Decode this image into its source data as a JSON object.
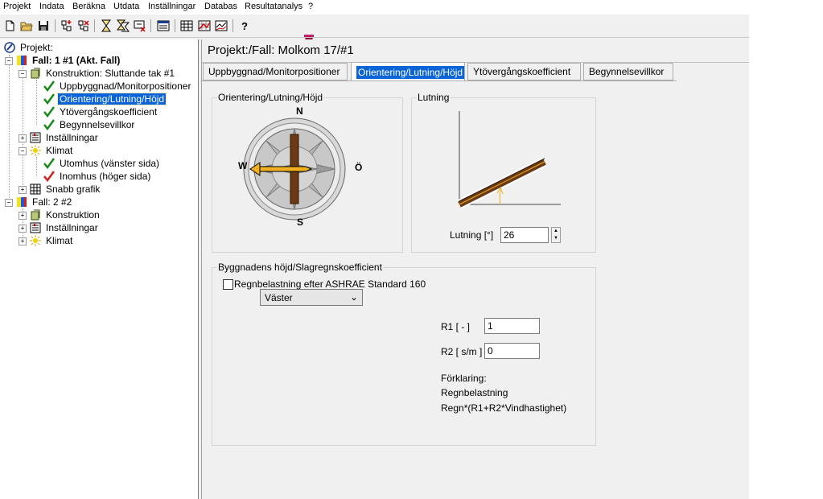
{
  "menu": [
    "Projekt",
    "Indata",
    "Beräkna",
    "Utdata",
    "Inställningar",
    "Databas",
    "Resultatanalys",
    "?"
  ],
  "toolbar": {
    "icons": [
      "new-file-icon",
      "open-folder-icon",
      "save-icon",
      "tree-add-icon",
      "tree-delete-icon",
      "calculate-icon",
      "calculate-multi-icon",
      "calculate-stop-icon",
      "report-icon",
      "grid-icon",
      "chart-grid-icon",
      "graph-icon",
      "help-icon",
      "exit-icon"
    ],
    "help_label": "?"
  },
  "tree": {
    "root": "Projekt:",
    "case1": "Fall: 1 #1 (Akt. Fall)",
    "construction1": "Konstruktion: Sluttande tak #1",
    "items1": [
      "Uppbyggnad/Monitorpositioner",
      "Orientering/Lutning/Höjd",
      "Ytövergångskoefficient",
      "Begynnelsevillkor"
    ],
    "settings1": "Inställningar",
    "climate1": "Klimat",
    "climate_items": [
      "Utomhus (vänster sida)",
      "Inomhus (höger sida)"
    ],
    "quick_graph": "Snabb grafik",
    "case2": "Fall: 2 #2",
    "construction2": "Konstruktion",
    "settings2": "Inställningar",
    "climate2": "Klimat",
    "expander_minus": "−",
    "expander_plus": "+"
  },
  "page": {
    "title": "Projekt:/Fall:  Molkom 17/#1",
    "tabs": [
      "Uppbyggnad/Monitorpositioner",
      "Orientering/Lutning/Höjd",
      "Ytövergångskoefficient",
      "Begynnelsevillkor"
    ],
    "active_tab": 1
  },
  "orientation": {
    "group_title": "Orientering/Lutning/Höjd",
    "compass": {
      "n": "N",
      "s": "S",
      "w": "W",
      "e": "Ö"
    },
    "direction_value": "Väster",
    "direction_chevron": "⌄"
  },
  "slope": {
    "group_title": "Lutning",
    "label": "Lutning [°]",
    "value": "26",
    "spin_up": "▲",
    "spin_down": "▼"
  },
  "building": {
    "group_title": "Byggnadens höjd/Slagregnskoefficient",
    "ashrae_label": "Regnbelastning efter ASHRAE Standard 160",
    "ashrae_checked": false,
    "r1_label": "R1 [ - ]",
    "r1_value": "1",
    "r2_label": "R2 [ s/m ]",
    "r2_value": "0",
    "explanation": [
      "Förklaring:",
      "Regnbelastning",
      "Regn*(R1+R2*Vindhastighet)"
    ]
  },
  "colors": {
    "selection": "#0a64d8",
    "check_green": "#1a8a1a",
    "check_red": "#d42020",
    "roof_brown": "#6b3a14",
    "arrow_orange": "#f0b020"
  }
}
